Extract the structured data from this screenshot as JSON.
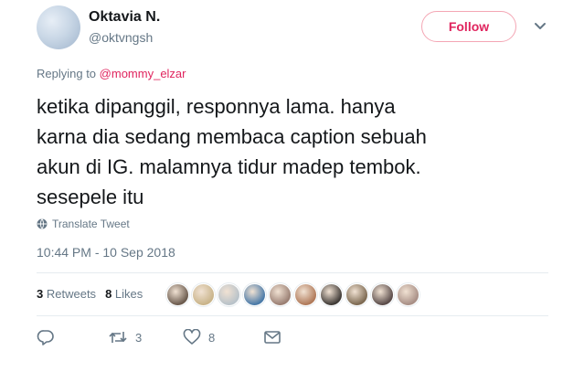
{
  "user": {
    "name": "Oktavia N.",
    "handle": "@oktvngsh"
  },
  "follow_label": "Follow",
  "reply_context": {
    "prefix": "Replying to",
    "mention": "@mommy_elzar"
  },
  "tweet": {
    "text_lines": [
      "ketika dipanggil, responnya lama. hanya",
      "karna dia sedang membaca caption sebuah",
      "akun di IG. malamnya tidur madep tembok.",
      "sesepele itu"
    ],
    "translate_label": "Translate Tweet",
    "timestamp": "10:44 PM - 10 Sep 2018"
  },
  "stats": {
    "retweets_count": "3",
    "retweets_label": "Retweets",
    "likes_count": "8",
    "likes_label": "Likes"
  },
  "liker_avatars": [
    "#6b5b4e",
    "#c9b48a",
    "#b8c2c9",
    "#4a7aa8",
    "#9a7f73",
    "#b07a5a",
    "#3f3a36",
    "#7d6a52",
    "#5a4c4a",
    "#a88f86"
  ],
  "actions": {
    "reply_icon": "reply-icon",
    "retweet_count": "3",
    "like_count": "8",
    "dm_icon": "envelope-icon"
  },
  "colors": {
    "accent_pink": "#e0245e",
    "muted_text": "#657786",
    "main_text": "#14171a"
  }
}
